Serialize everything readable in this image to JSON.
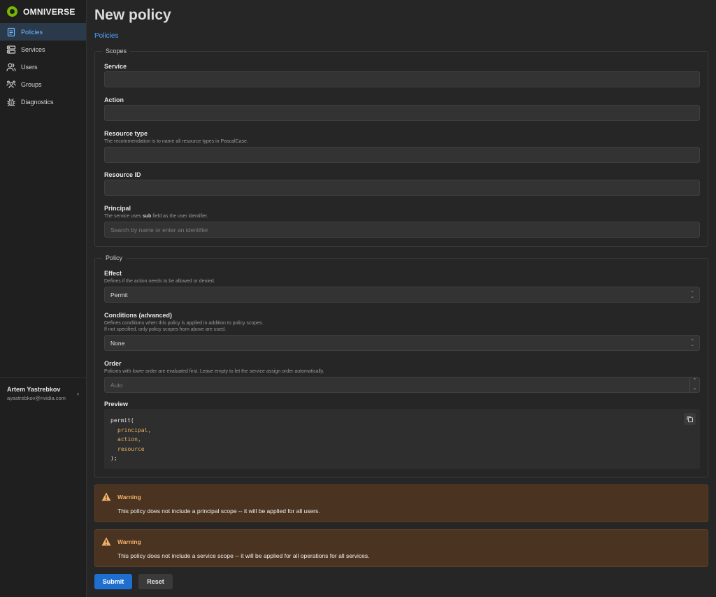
{
  "app": {
    "brand": "OMNIVERSE",
    "brand_color": "#76b900"
  },
  "sidebar": {
    "items": [
      {
        "label": "Policies",
        "icon": "document-icon",
        "active": true
      },
      {
        "label": "Services",
        "icon": "server-icon"
      },
      {
        "label": "Users",
        "icon": "users-icon"
      },
      {
        "label": "Groups",
        "icon": "groups-icon"
      },
      {
        "label": "Diagnostics",
        "icon": "bug-icon"
      }
    ],
    "user": {
      "name": "Artem Yastrebkov",
      "email": "ayastrebkov@nvidia.com"
    }
  },
  "page": {
    "title": "New policy",
    "breadcrumb": "Policies"
  },
  "scopes": {
    "legend": "Scopes",
    "service": {
      "label": "Service",
      "value": ""
    },
    "action": {
      "label": "Action",
      "value": ""
    },
    "resource_type": {
      "label": "Resource type",
      "help": "The recommendation is to name all resource types in PascalCase.",
      "value": ""
    },
    "resource_id": {
      "label": "Resource ID",
      "value": ""
    },
    "principal": {
      "label": "Principal",
      "help_before": "The service uses ",
      "help_bold": "sub",
      "help_after": " field as the user identifier.",
      "placeholder": "Search by name or enter an identifier"
    }
  },
  "policy": {
    "legend": "Policy",
    "effect": {
      "label": "Effect",
      "help": "Defines if the action needs to be allowed or denied.",
      "value": "Permit"
    },
    "conditions": {
      "label": "Conditions (advanced)",
      "help_line1": "Defines conditions when this policy is applied in addition to policy scopes.",
      "help_line2": "If not specified, only policy scopes from above are used.",
      "value": "None"
    },
    "order": {
      "label": "Order",
      "help": "Policies with lower order are evaluated first. Leave empty to let the service assign order automatically.",
      "placeholder": "Auto"
    },
    "preview": {
      "label": "Preview",
      "open": "permit(",
      "args": [
        "principal,",
        "action,",
        "resource"
      ],
      "close": ");"
    }
  },
  "warnings": [
    {
      "title": "Warning",
      "text": "This policy does not include a principal scope -- it will be applied for all users."
    },
    {
      "title": "Warning",
      "text": "This policy does not include a service scope -- it will be applied for all operations for all services."
    }
  ],
  "buttons": {
    "submit": "Submit",
    "reset": "Reset"
  },
  "colors": {
    "accent": "#1f6fd1",
    "link": "#4fa3ff",
    "warning_bg": "#4a3320",
    "warning_title": "#f2b36b"
  }
}
